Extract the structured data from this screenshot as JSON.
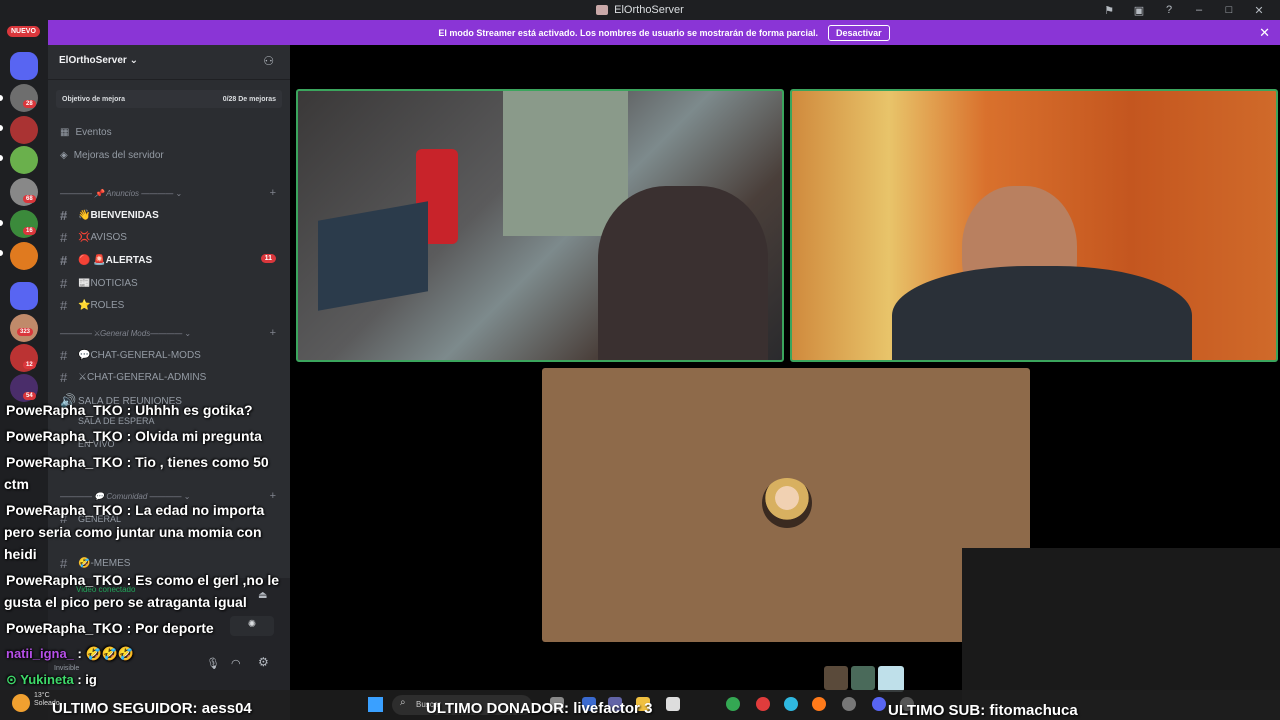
{
  "window": {
    "title": "ElOrthoServer",
    "controls": [
      "flag-icon",
      "inbox-icon",
      "help-icon",
      "minimize-icon",
      "maximize-icon",
      "close-icon"
    ]
  },
  "streamer_banner": {
    "text": "El modo Streamer está activado. Los nombres de usuario se mostrarán de forma parcial.",
    "button": "Desactivar",
    "bg_color": "#8a35d6"
  },
  "rail": {
    "new_label": "NUEVO",
    "badges": [
      "28",
      "68",
      "16",
      "323",
      "12",
      "54"
    ]
  },
  "sidebar": {
    "server_name": "ElOrthoServer",
    "boost_goal": {
      "label": "Objetivo de mejora",
      "progress": "0/28 De mejoras"
    },
    "items": [
      {
        "label": "Eventos",
        "icon": "calendar-icon"
      },
      {
        "label": "Mejoras del servidor",
        "icon": "boost-icon"
      }
    ],
    "categories": [
      {
        "label": "———— 📌 Anuncios ———— ⌄"
      },
      {
        "label": "———— ⚔General Mods———— ⌄"
      },
      {
        "label": "———— 💬 Comunidad ———— ⌄"
      }
    ],
    "channels": [
      {
        "label": "👋BIENVENIDAS",
        "bold": true
      },
      {
        "label": "💢AVISOS",
        "bold": false
      },
      {
        "label": "🔴 🚨ALERTAS",
        "bold": true,
        "badge": "11"
      },
      {
        "label": "📰NOTICIAS",
        "bold": false
      },
      {
        "label": "⭐ROLES",
        "bold": false
      },
      {
        "label": "💬CHAT-GENERAL-MODS",
        "bold": false
      },
      {
        "label": "⚔CHAT-GENERAL-ADMINS",
        "bold": false
      },
      {
        "label": "SALA DE REUNIONES",
        "bold": false
      },
      {
        "label": "SALA DE ESPERA",
        "bold": false
      },
      {
        "label": "EN VIVO",
        "bold": false
      },
      {
        "label": "GENERAL",
        "bold": false
      },
      {
        "label": "🤣-MEMES",
        "bold": false
      }
    ],
    "voice_status": "Video conectado",
    "user_status": "Invisible"
  },
  "chat": [
    {
      "user": "PoweRapha_TKO",
      "text": " : Uhhhh es gotika?"
    },
    {
      "user": "PoweRapha_TKO",
      "text": " : Olvida mi pregunta"
    },
    {
      "user": "PoweRapha_TKO",
      "text": " : Tio , tienes como 50"
    },
    {
      "user": "",
      "text": "ctm"
    },
    {
      "user": "PoweRapha_TKO",
      "text": " : La edad no importa"
    },
    {
      "user": "",
      "text": "pero seria como juntar una momia con"
    },
    {
      "user": "",
      "text": "heidi"
    },
    {
      "user": "PoweRapha_TKO",
      "text": " : Es como el gerl ,no le"
    },
    {
      "user": "",
      "text": "gusta el pico pero se atraganta igual"
    },
    {
      "user": "PoweRapha_TKO",
      "text": " : Por deporte"
    },
    {
      "user": "natii_igna_",
      "text": " : 🤣🤣🤣"
    },
    {
      "user": "Yukineta",
      "text": " : ig"
    }
  ],
  "taskbar": {
    "weather_temp": "13°C",
    "weather_desc": "Soleado",
    "search_placeholder": "Buscar",
    "last_follower": "ULTIMO SEGUIDOR: aess04",
    "last_donor": "ULTIMO DONADOR: livefactor  3",
    "last_sub": "ULTIMO SUB: fitomachuca"
  }
}
